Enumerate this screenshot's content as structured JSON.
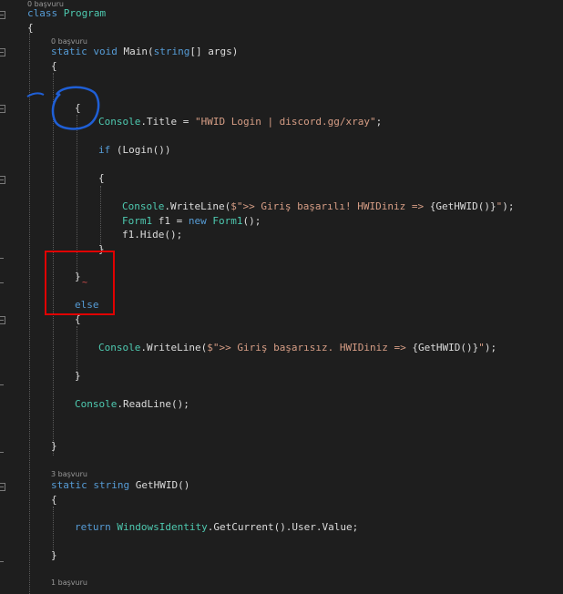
{
  "code": {
    "class_lens": "0 başvuru",
    "class_kw": "class",
    "class_name": "Program",
    "brace_open": "{",
    "main_lens": "0 başvuru",
    "main_kw1": "static",
    "main_kw2": "void",
    "main_name": "Main(",
    "main_kw3": "string",
    "main_rest": "[] args)",
    "main_brace": "{",
    "block_brace": "{",
    "title_type": "Console",
    "title_mid": ".Title = ",
    "title_str": "\"HWID Login | discord.gg/xray\"",
    "title_end": ";",
    "if_kw": "if",
    "if_rest": " (Login())",
    "if_brace": "{",
    "wl1_type": "Console",
    "wl1_mid": ".WriteLine(",
    "wl1_str": "$\">> Giriş başarılı! HWIDiniz => ",
    "wl1_interp": "{GetHWID()}",
    "wl1_strend": "\"",
    "wl1_end": ");",
    "form_type": "Form1",
    "form_mid": " f1 = ",
    "form_kw": "new",
    "form_type2": "Form1",
    "form_end": "();",
    "hide": "f1.Hide();",
    "if_close": "}",
    "block_close": "}",
    "squiggle": "~",
    "else_kw": "else",
    "else_brace": "{",
    "wl2_type": "Console",
    "wl2_mid": ".WriteLine(",
    "wl2_str": "$\">> Giriş başarısız. HWIDiniz => ",
    "wl2_interp": "{GetHWID()}",
    "wl2_strend": "\"",
    "wl2_end": ");",
    "else_close": "}",
    "rl_type": "Console",
    "rl_rest": ".ReadLine();",
    "main_close": "}",
    "gh_lens": "3 başvuru",
    "gh_kw1": "static",
    "gh_kw2": "string",
    "gh_name": "GetHWID()",
    "gh_brace": "{",
    "ret_kw": "return",
    "ret_type": "WindowsIdentity",
    "ret_rest": ".GetCurrent().User.Value;",
    "gh_close": "}",
    "login_lens": "1 başvuru"
  },
  "colors": {
    "keyword": "#569cd6",
    "type": "#4ec9b0",
    "string": "#d69d85",
    "plain": "#dcdcdc",
    "annotation_red": "#e00000",
    "annotation_blue": "#1f5fd6"
  }
}
